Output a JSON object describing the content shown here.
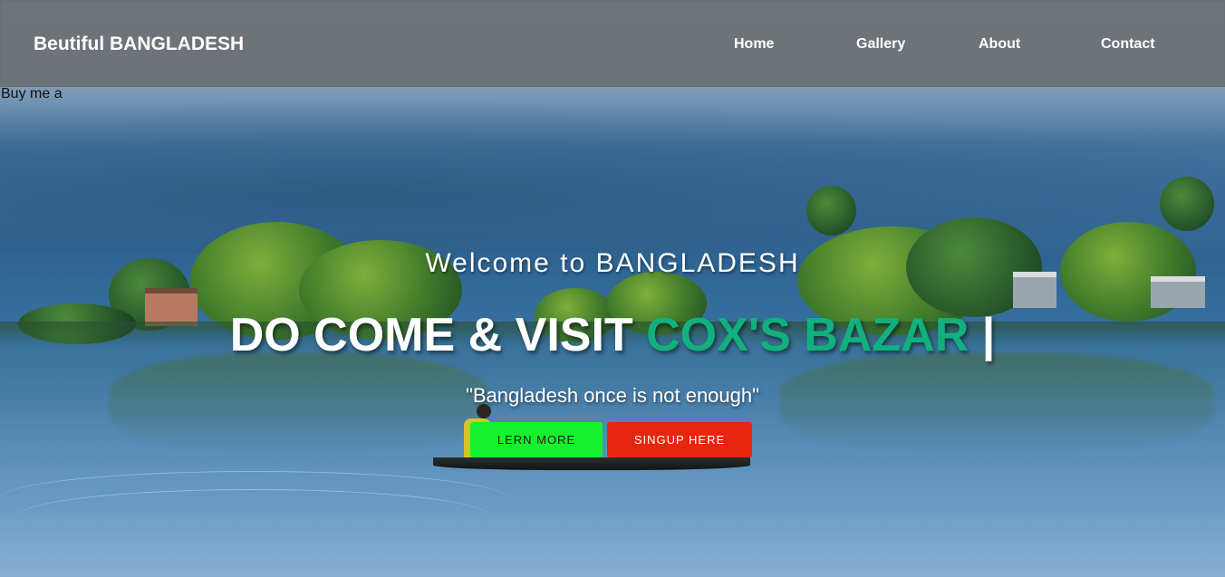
{
  "header": {
    "brand": "Beutiful BANGLADESH",
    "nav": [
      {
        "label": "Home"
      },
      {
        "label": "Gallery"
      },
      {
        "label": "About"
      },
      {
        "label": "Contact"
      }
    ]
  },
  "hero": {
    "small_text": "Buy me a",
    "welcome": "Welcome to BANGLADESH",
    "headline_main": "DO COME & VISIT ",
    "headline_accent": "COX'S BAZAR",
    "headline_cursor": " |",
    "quote": "\"Bangladesh once is not enough\"",
    "buttons": {
      "learn_more": "LERN MORE",
      "signup": "SINGUP HERE"
    }
  },
  "colors": {
    "accent": "#12b07e",
    "learn_button": "#17f02f",
    "signup_button": "#e8250f",
    "navbar": "#6e7378"
  }
}
